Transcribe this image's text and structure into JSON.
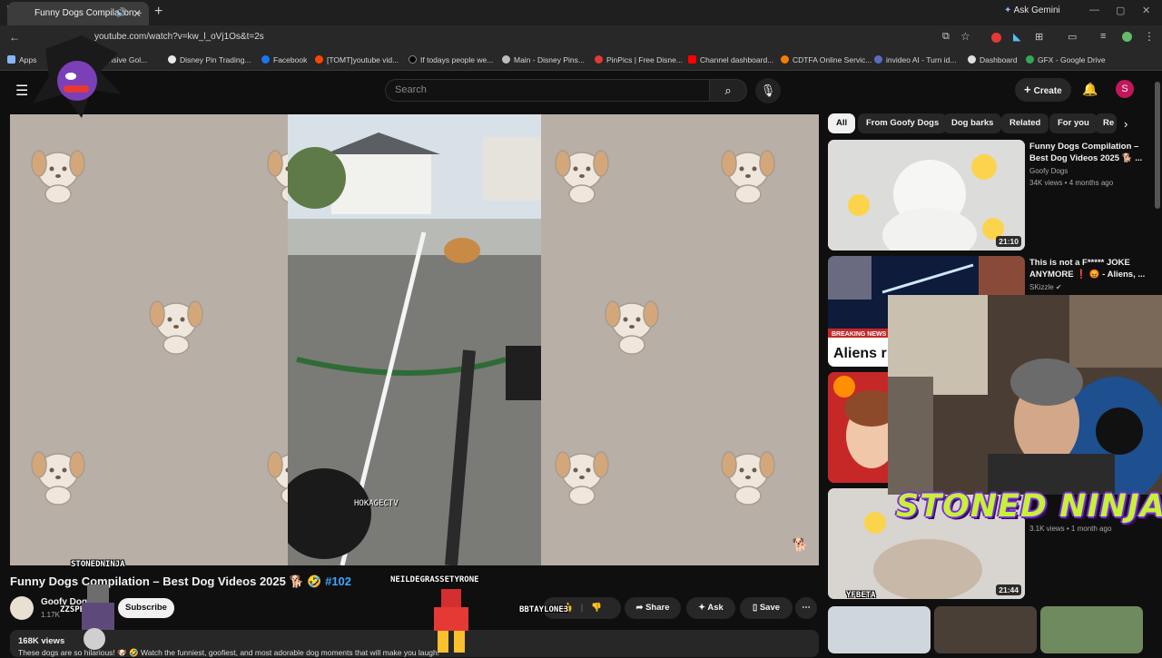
{
  "browser": {
    "tab_title": "Funny Dogs Compilation –",
    "url": "youtube.com/watch?v=kw_l_oVj1Os&t=2s",
    "gemini_label": "Ask Gemini",
    "bookmarks": [
      {
        "label": "Apps",
        "color": "#8ab4f8"
      },
      {
        "label": "Co...ensive Gol...",
        "color": "#9aa0a6"
      },
      {
        "label": "Disney Pin Trading...",
        "color": "#e8eaed"
      },
      {
        "label": "Facebook",
        "color": "#1877f2"
      },
      {
        "label": "[TOMT]youtube vid...",
        "color": "#ff4500"
      },
      {
        "label": "If todays people we...",
        "color": "#000000"
      },
      {
        "label": "Main - Disney Pins...",
        "color": "#bdbdbd"
      },
      {
        "label": "PinPics | Free Disne...",
        "color": "#e53935"
      },
      {
        "label": "Channel dashboard...",
        "color": "#ff0000"
      },
      {
        "label": "CDTFA Online Servic...",
        "color": "#f57c00"
      },
      {
        "label": "invideo AI - Turn id...",
        "color": "#5c6bc0"
      },
      {
        "label": "Dashboard",
        "color": "#e0e0e0"
      },
      {
        "label": "GFX - Google Drive",
        "color": "#34a853"
      }
    ]
  },
  "youtube": {
    "search_placeholder": "Search",
    "create_label": "Create",
    "avatar_letter": "S"
  },
  "video": {
    "title": "Funny Dogs Compilation – Best Dog Videos 2025 🐕 🤣",
    "hashtag": "#102",
    "channel": "Goofy Dogs",
    "subscribers": "1.17K",
    "subscribe_label": "Subscribe",
    "views": "168K views",
    "description": "These dogs are so hilarious! 🐶 🤣 Watch the funniest, goofiest, and most adorable dog moments that will make you laugh!",
    "share_label": "Share",
    "ask_label": "Ask",
    "save_label": "Save",
    "clip_credit": "HOKAGECTV"
  },
  "chips": [
    "All",
    "From Goofy Dogs",
    "Dog barks",
    "Related",
    "For you",
    "Re"
  ],
  "related": [
    {
      "title": "Funny Dogs Compilation – Best Dog Videos 2025 🐕 ...",
      "channel": "Goofy Dogs",
      "meta": "34K views • 4 months ago",
      "duration": "21:10"
    },
    {
      "title": "This is not a F***** JOKE ANYMORE ❗ 😡 - Aliens, ...",
      "channel": "SKizzle",
      "meta": "",
      "duration": ""
    },
    {
      "title": "",
      "channel": "",
      "meta": "",
      "duration": ""
    },
    {
      "title": "",
      "channel": "",
      "meta": "3.1K views • 1 month ago",
      "duration": "21:44"
    }
  ],
  "related_overlay_text": {
    "breaking": "BREAKING NEWS",
    "aliens": "Aliens r"
  },
  "overlays": {
    "streamer_name": "STONED NINJA",
    "chat_names": [
      "STONEDNINJA",
      "ZZSPENCER",
      "NEILDEGRASSETYRONE",
      "BBTAYLONE3",
      "YFBETA"
    ]
  }
}
